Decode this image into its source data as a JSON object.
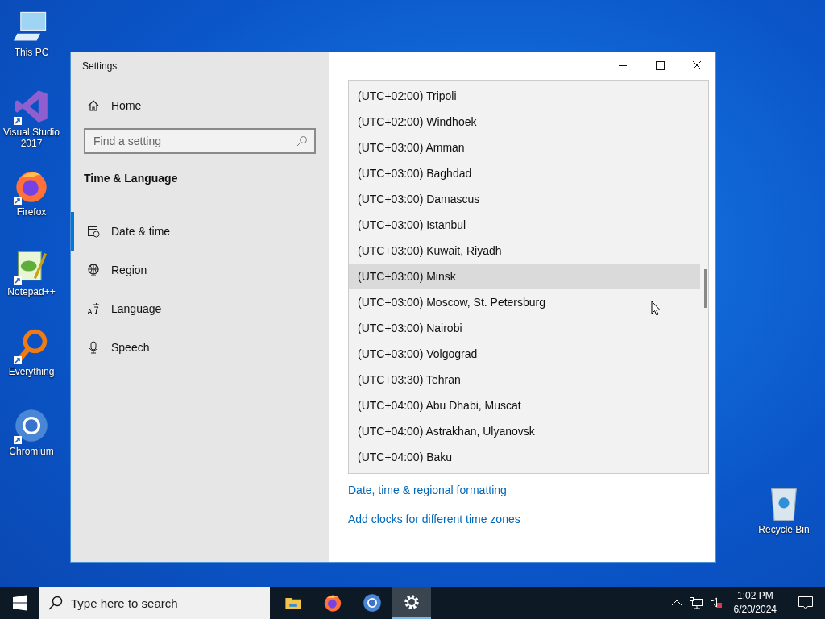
{
  "desktop_icons": [
    {
      "kind": "pc",
      "label": "This PC",
      "shortcut": false
    },
    {
      "kind": "vs",
      "label": "Visual Studio 2017",
      "shortcut": true
    },
    {
      "kind": "firefox",
      "label": "Firefox",
      "shortcut": true
    },
    {
      "kind": "notepad",
      "label": "Notepad++",
      "shortcut": true
    },
    {
      "kind": "everything",
      "label": "Everything",
      "shortcut": true
    },
    {
      "kind": "chromium",
      "label": "Chromium",
      "shortcut": true
    }
  ],
  "recycle_bin": {
    "label": "Recycle Bin"
  },
  "window": {
    "title": "Settings",
    "home": "Home",
    "search": {
      "placeholder": "Find a setting"
    },
    "section_title": "Time & Language",
    "nav": [
      {
        "kind": "date",
        "label": "Date & time",
        "selected": true
      },
      {
        "kind": "region",
        "label": "Region",
        "selected": false
      },
      {
        "kind": "language",
        "label": "Language",
        "selected": false
      },
      {
        "kind": "speech",
        "label": "Speech",
        "selected": false
      }
    ]
  },
  "timezone_list": [
    {
      "label": "(UTC+02:00) Tripoli",
      "selected": false
    },
    {
      "label": "(UTC+02:00) Windhoek",
      "selected": false
    },
    {
      "label": "(UTC+03:00) Amman",
      "selected": false
    },
    {
      "label": "(UTC+03:00) Baghdad",
      "selected": false
    },
    {
      "label": "(UTC+03:00) Damascus",
      "selected": false
    },
    {
      "label": "(UTC+03:00) Istanbul",
      "selected": false
    },
    {
      "label": "(UTC+03:00) Kuwait, Riyadh",
      "selected": false
    },
    {
      "label": "(UTC+03:00) Minsk",
      "selected": true
    },
    {
      "label": "(UTC+03:00) Moscow, St. Petersburg",
      "selected": false
    },
    {
      "label": "(UTC+03:00) Nairobi",
      "selected": false
    },
    {
      "label": "(UTC+03:00) Volgograd",
      "selected": false
    },
    {
      "label": "(UTC+03:30) Tehran",
      "selected": false
    },
    {
      "label": "(UTC+04:00) Abu Dhabi, Muscat",
      "selected": false
    },
    {
      "label": "(UTC+04:00) Astrakhan, Ulyanovsk",
      "selected": false
    },
    {
      "label": "(UTC+04:00) Baku",
      "selected": false
    }
  ],
  "links": [
    "Date, time & regional formatting",
    "Add clocks for different time zones"
  ],
  "taskbar": {
    "search": {
      "placeholder": "Type here to search"
    },
    "apps": [
      {
        "kind": "folder",
        "selected": false
      },
      {
        "kind": "firefox",
        "selected": false
      },
      {
        "kind": "chromium",
        "selected": false
      },
      {
        "kind": "settings",
        "selected": true
      }
    ],
    "time": "1:02 PM",
    "date": "6/20/2024"
  }
}
